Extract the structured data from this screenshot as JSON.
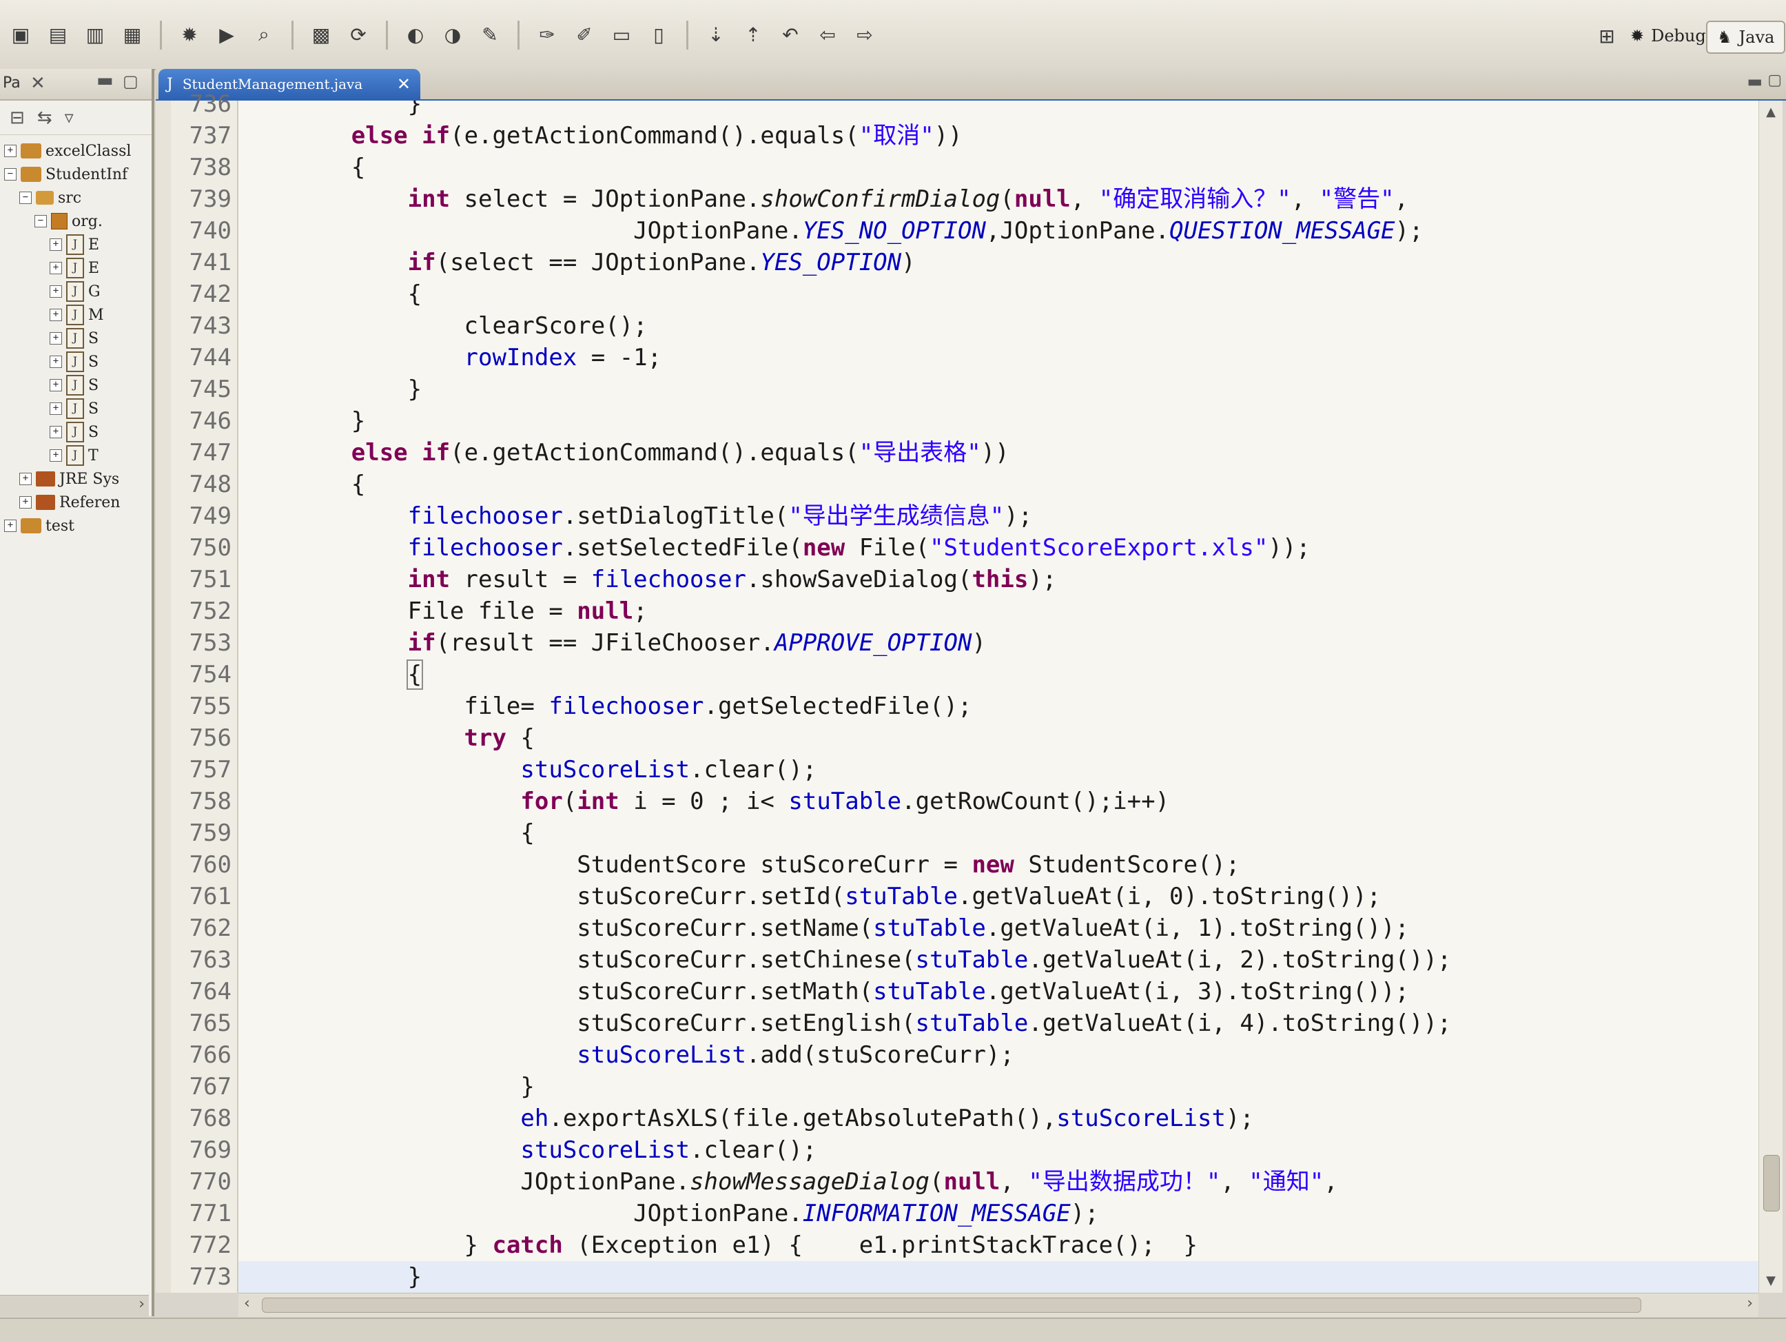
{
  "toolbar": {
    "perspectives": [
      {
        "label": "Debug",
        "icon": "bug-icon"
      },
      {
        "label": "Java",
        "icon": "java-perspective-icon"
      }
    ]
  },
  "explorer": {
    "title": "Pa",
    "tree": [
      {
        "label": "excelClassl",
        "icon": "project-icon",
        "expanded": false
      },
      {
        "label": "StudentInf",
        "icon": "project-icon",
        "expanded": true
      },
      {
        "label": "src",
        "icon": "source-folder-icon",
        "expanded": true
      },
      {
        "label": "org.",
        "icon": "package-icon",
        "expanded": true
      },
      {
        "label": "E",
        "icon": "java-file-icon"
      },
      {
        "label": "E",
        "icon": "java-file-icon"
      },
      {
        "label": "G",
        "icon": "java-file-icon"
      },
      {
        "label": "M",
        "icon": "java-file-icon"
      },
      {
        "label": "S",
        "icon": "java-file-icon"
      },
      {
        "label": "S",
        "icon": "java-file-icon"
      },
      {
        "label": "S",
        "icon": "java-file-icon"
      },
      {
        "label": "S",
        "icon": "java-file-icon"
      },
      {
        "label": "S",
        "icon": "java-file-icon"
      },
      {
        "label": "T",
        "icon": "java-file-icon"
      },
      {
        "label": "JRE Sys",
        "icon": "library-icon"
      },
      {
        "label": "Referen",
        "icon": "library-icon"
      },
      {
        "label": "test",
        "icon": "project-icon"
      }
    ]
  },
  "editor": {
    "tab_label": "StudentManagement.java",
    "lines": [
      {
        "num": "736",
        "tokens": [
          {
            "t": "            }"
          }
        ]
      },
      {
        "num": "737",
        "tokens": [
          {
            "t": "        "
          },
          {
            "t": "else",
            "c": "kw"
          },
          {
            "t": " "
          },
          {
            "t": "if",
            "c": "kw"
          },
          {
            "t": "(e.getActionCommand().equals("
          },
          {
            "t": "\"取消\"",
            "c": "str"
          },
          {
            "t": "))"
          }
        ]
      },
      {
        "num": "738",
        "tokens": [
          {
            "t": "        {"
          }
        ]
      },
      {
        "num": "739",
        "tokens": [
          {
            "t": "            "
          },
          {
            "t": "int",
            "c": "kw"
          },
          {
            "t": " select = JOptionPane."
          },
          {
            "t": "showConfirmDialog",
            "c": "smeth"
          },
          {
            "t": "("
          },
          {
            "t": "null",
            "c": "kw"
          },
          {
            "t": ", "
          },
          {
            "t": "\"确定取消输入？\"",
            "c": "str"
          },
          {
            "t": ", "
          },
          {
            "t": "\"警告\"",
            "c": "str"
          },
          {
            "t": ","
          }
        ]
      },
      {
        "num": "740",
        "tokens": [
          {
            "t": "                            JOptionPane."
          },
          {
            "t": "YES_NO_OPTION",
            "c": "sfld"
          },
          {
            "t": ",JOptionPane."
          },
          {
            "t": "QUESTION_MESSAGE",
            "c": "sfld"
          },
          {
            "t": ");"
          }
        ]
      },
      {
        "num": "741",
        "tokens": [
          {
            "t": "            "
          },
          {
            "t": "if",
            "c": "kw"
          },
          {
            "t": "(select == JOptionPane."
          },
          {
            "t": "YES_OPTION",
            "c": "sfld"
          },
          {
            "t": ")"
          }
        ]
      },
      {
        "num": "742",
        "tokens": [
          {
            "t": "            {"
          }
        ]
      },
      {
        "num": "743",
        "tokens": [
          {
            "t": "                clearScore();"
          }
        ]
      },
      {
        "num": "744",
        "tokens": [
          {
            "t": "                "
          },
          {
            "t": "rowIndex",
            "c": "fld"
          },
          {
            "t": " = -1;"
          }
        ]
      },
      {
        "num": "745",
        "tokens": [
          {
            "t": "            }"
          }
        ]
      },
      {
        "num": "746",
        "tokens": [
          {
            "t": "        }"
          }
        ]
      },
      {
        "num": "747",
        "tokens": [
          {
            "t": "        "
          },
          {
            "t": "else",
            "c": "kw"
          },
          {
            "t": " "
          },
          {
            "t": "if",
            "c": "kw"
          },
          {
            "t": "(e.getActionCommand().equals("
          },
          {
            "t": "\"导出表格\"",
            "c": "str"
          },
          {
            "t": "))"
          }
        ]
      },
      {
        "num": "748",
        "tokens": [
          {
            "t": "        {"
          }
        ]
      },
      {
        "num": "749",
        "tokens": [
          {
            "t": "            "
          },
          {
            "t": "filechooser",
            "c": "fld"
          },
          {
            "t": ".setDialogTitle("
          },
          {
            "t": "\"导出学生成绩信息\"",
            "c": "str"
          },
          {
            "t": ");"
          }
        ]
      },
      {
        "num": "750",
        "tokens": [
          {
            "t": "            "
          },
          {
            "t": "filechooser",
            "c": "fld"
          },
          {
            "t": ".setSelectedFile("
          },
          {
            "t": "new",
            "c": "kw"
          },
          {
            "t": " File("
          },
          {
            "t": "\"StudentScoreExport.xls\"",
            "c": "str"
          },
          {
            "t": "));"
          }
        ]
      },
      {
        "num": "751",
        "tokens": [
          {
            "t": "            "
          },
          {
            "t": "int",
            "c": "kw"
          },
          {
            "t": " result = "
          },
          {
            "t": "filechooser",
            "c": "fld"
          },
          {
            "t": ".showSaveDialog("
          },
          {
            "t": "this",
            "c": "kw"
          },
          {
            "t": ");"
          }
        ]
      },
      {
        "num": "752",
        "tokens": [
          {
            "t": "            File file = "
          },
          {
            "t": "null",
            "c": "kw"
          },
          {
            "t": ";"
          }
        ]
      },
      {
        "num": "753",
        "tokens": [
          {
            "t": "            "
          },
          {
            "t": "if",
            "c": "kw"
          },
          {
            "t": "(result == JFileChooser."
          },
          {
            "t": "APPROVE_OPTION",
            "c": "sfld"
          },
          {
            "t": ")"
          }
        ]
      },
      {
        "num": "754",
        "tokens": [
          {
            "t": "            "
          },
          {
            "t": "{",
            "c": "bracket-match"
          }
        ]
      },
      {
        "num": "755",
        "tokens": [
          {
            "t": "                file= "
          },
          {
            "t": "filechooser",
            "c": "fld"
          },
          {
            "t": ".getSelectedFile();"
          }
        ]
      },
      {
        "num": "756",
        "tokens": [
          {
            "t": "                "
          },
          {
            "t": "try",
            "c": "kw"
          },
          {
            "t": " {"
          }
        ]
      },
      {
        "num": "757",
        "tokens": [
          {
            "t": "                    "
          },
          {
            "t": "stuScoreList",
            "c": "fld"
          },
          {
            "t": ".clear();"
          }
        ]
      },
      {
        "num": "758",
        "tokens": [
          {
            "t": "                    "
          },
          {
            "t": "for",
            "c": "kw"
          },
          {
            "t": "("
          },
          {
            "t": "int",
            "c": "kw"
          },
          {
            "t": " i = 0 ; i< "
          },
          {
            "t": "stuTable",
            "c": "fld"
          },
          {
            "t": ".getRowCount();i++)"
          }
        ]
      },
      {
        "num": "759",
        "tokens": [
          {
            "t": "                    {"
          }
        ]
      },
      {
        "num": "760",
        "tokens": [
          {
            "t": "                        StudentScore stuScoreCurr = "
          },
          {
            "t": "new",
            "c": "kw"
          },
          {
            "t": " StudentScore();"
          }
        ]
      },
      {
        "num": "761",
        "tokens": [
          {
            "t": "                        stuScoreCurr.setId("
          },
          {
            "t": "stuTable",
            "c": "fld"
          },
          {
            "t": ".getValueAt(i, 0).toString());"
          }
        ]
      },
      {
        "num": "762",
        "tokens": [
          {
            "t": "                        stuScoreCurr.setName("
          },
          {
            "t": "stuTable",
            "c": "fld"
          },
          {
            "t": ".getValueAt(i, 1).toString());"
          }
        ]
      },
      {
        "num": "763",
        "tokens": [
          {
            "t": "                        stuScoreCurr.setChinese("
          },
          {
            "t": "stuTable",
            "c": "fld"
          },
          {
            "t": ".getValueAt(i, 2).toString());"
          }
        ]
      },
      {
        "num": "764",
        "tokens": [
          {
            "t": "                        stuScoreCurr.setMath("
          },
          {
            "t": "stuTable",
            "c": "fld"
          },
          {
            "t": ".getValueAt(i, 3).toString());"
          }
        ]
      },
      {
        "num": "765",
        "tokens": [
          {
            "t": "                        stuScoreCurr.setEnglish("
          },
          {
            "t": "stuTable",
            "c": "fld"
          },
          {
            "t": ".getValueAt(i, 4).toString());"
          }
        ]
      },
      {
        "num": "766",
        "tokens": [
          {
            "t": "                        "
          },
          {
            "t": "stuScoreList",
            "c": "fld"
          },
          {
            "t": ".add(stuScoreCurr);"
          }
        ]
      },
      {
        "num": "767",
        "tokens": [
          {
            "t": "                    }"
          }
        ]
      },
      {
        "num": "768",
        "tokens": [
          {
            "t": "                    "
          },
          {
            "t": "eh",
            "c": "fld"
          },
          {
            "t": ".exportAsXLS(file.getAbsolutePath(),"
          },
          {
            "t": "stuScoreList",
            "c": "fld"
          },
          {
            "t": ");"
          }
        ]
      },
      {
        "num": "769",
        "tokens": [
          {
            "t": "                    "
          },
          {
            "t": "stuScoreList",
            "c": "fld"
          },
          {
            "t": ".clear();"
          }
        ]
      },
      {
        "num": "770",
        "tokens": [
          {
            "t": "                    JOptionPane."
          },
          {
            "t": "showMessageDialog",
            "c": "smeth"
          },
          {
            "t": "("
          },
          {
            "t": "null",
            "c": "kw"
          },
          {
            "t": ", "
          },
          {
            "t": "\"导出数据成功！\"",
            "c": "str"
          },
          {
            "t": ", "
          },
          {
            "t": "\"通知\"",
            "c": "str"
          },
          {
            "t": ","
          }
        ]
      },
      {
        "num": "771",
        "tokens": [
          {
            "t": "                            JOptionPane."
          },
          {
            "t": "INFORMATION_MESSAGE",
            "c": "sfld"
          },
          {
            "t": ");"
          }
        ]
      },
      {
        "num": "772",
        "tokens": [
          {
            "t": "                } "
          },
          {
            "t": "catch",
            "c": "kw"
          },
          {
            "t": " (Exception e1) {    e1.printStackTrace();  }"
          }
        ]
      },
      {
        "num": "773",
        "tokens": [
          {
            "t": "            }"
          }
        ],
        "current": true
      }
    ]
  }
}
